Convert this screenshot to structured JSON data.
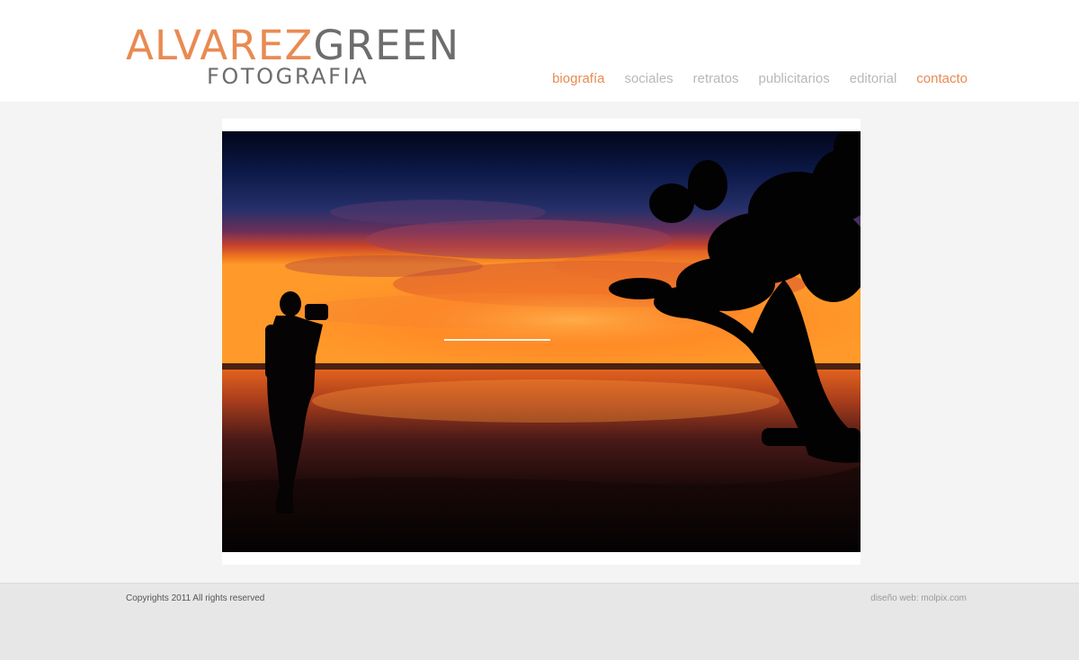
{
  "brand": {
    "name_part1": "ALVAREZ",
    "name_part2": "GREEN",
    "subtitle": "FOTOGRAFIA",
    "accent_color": "#e98a52",
    "gray_color": "#6d6d6d"
  },
  "nav": {
    "items": [
      {
        "label": "biografía",
        "active": true
      },
      {
        "label": "sociales",
        "active": false
      },
      {
        "label": "retratos",
        "active": false
      },
      {
        "label": "publicitarios",
        "active": false
      },
      {
        "label": "editorial",
        "active": false
      },
      {
        "label": "contacto",
        "active": true
      }
    ]
  },
  "main": {
    "photo_subject": "sunset silhouette of photographer and tree by the sea"
  },
  "footer": {
    "copyright": "Copyrights 2011 All rights reserved",
    "credit_prefix": "diseño web: ",
    "credit_link": "molpix.com"
  }
}
